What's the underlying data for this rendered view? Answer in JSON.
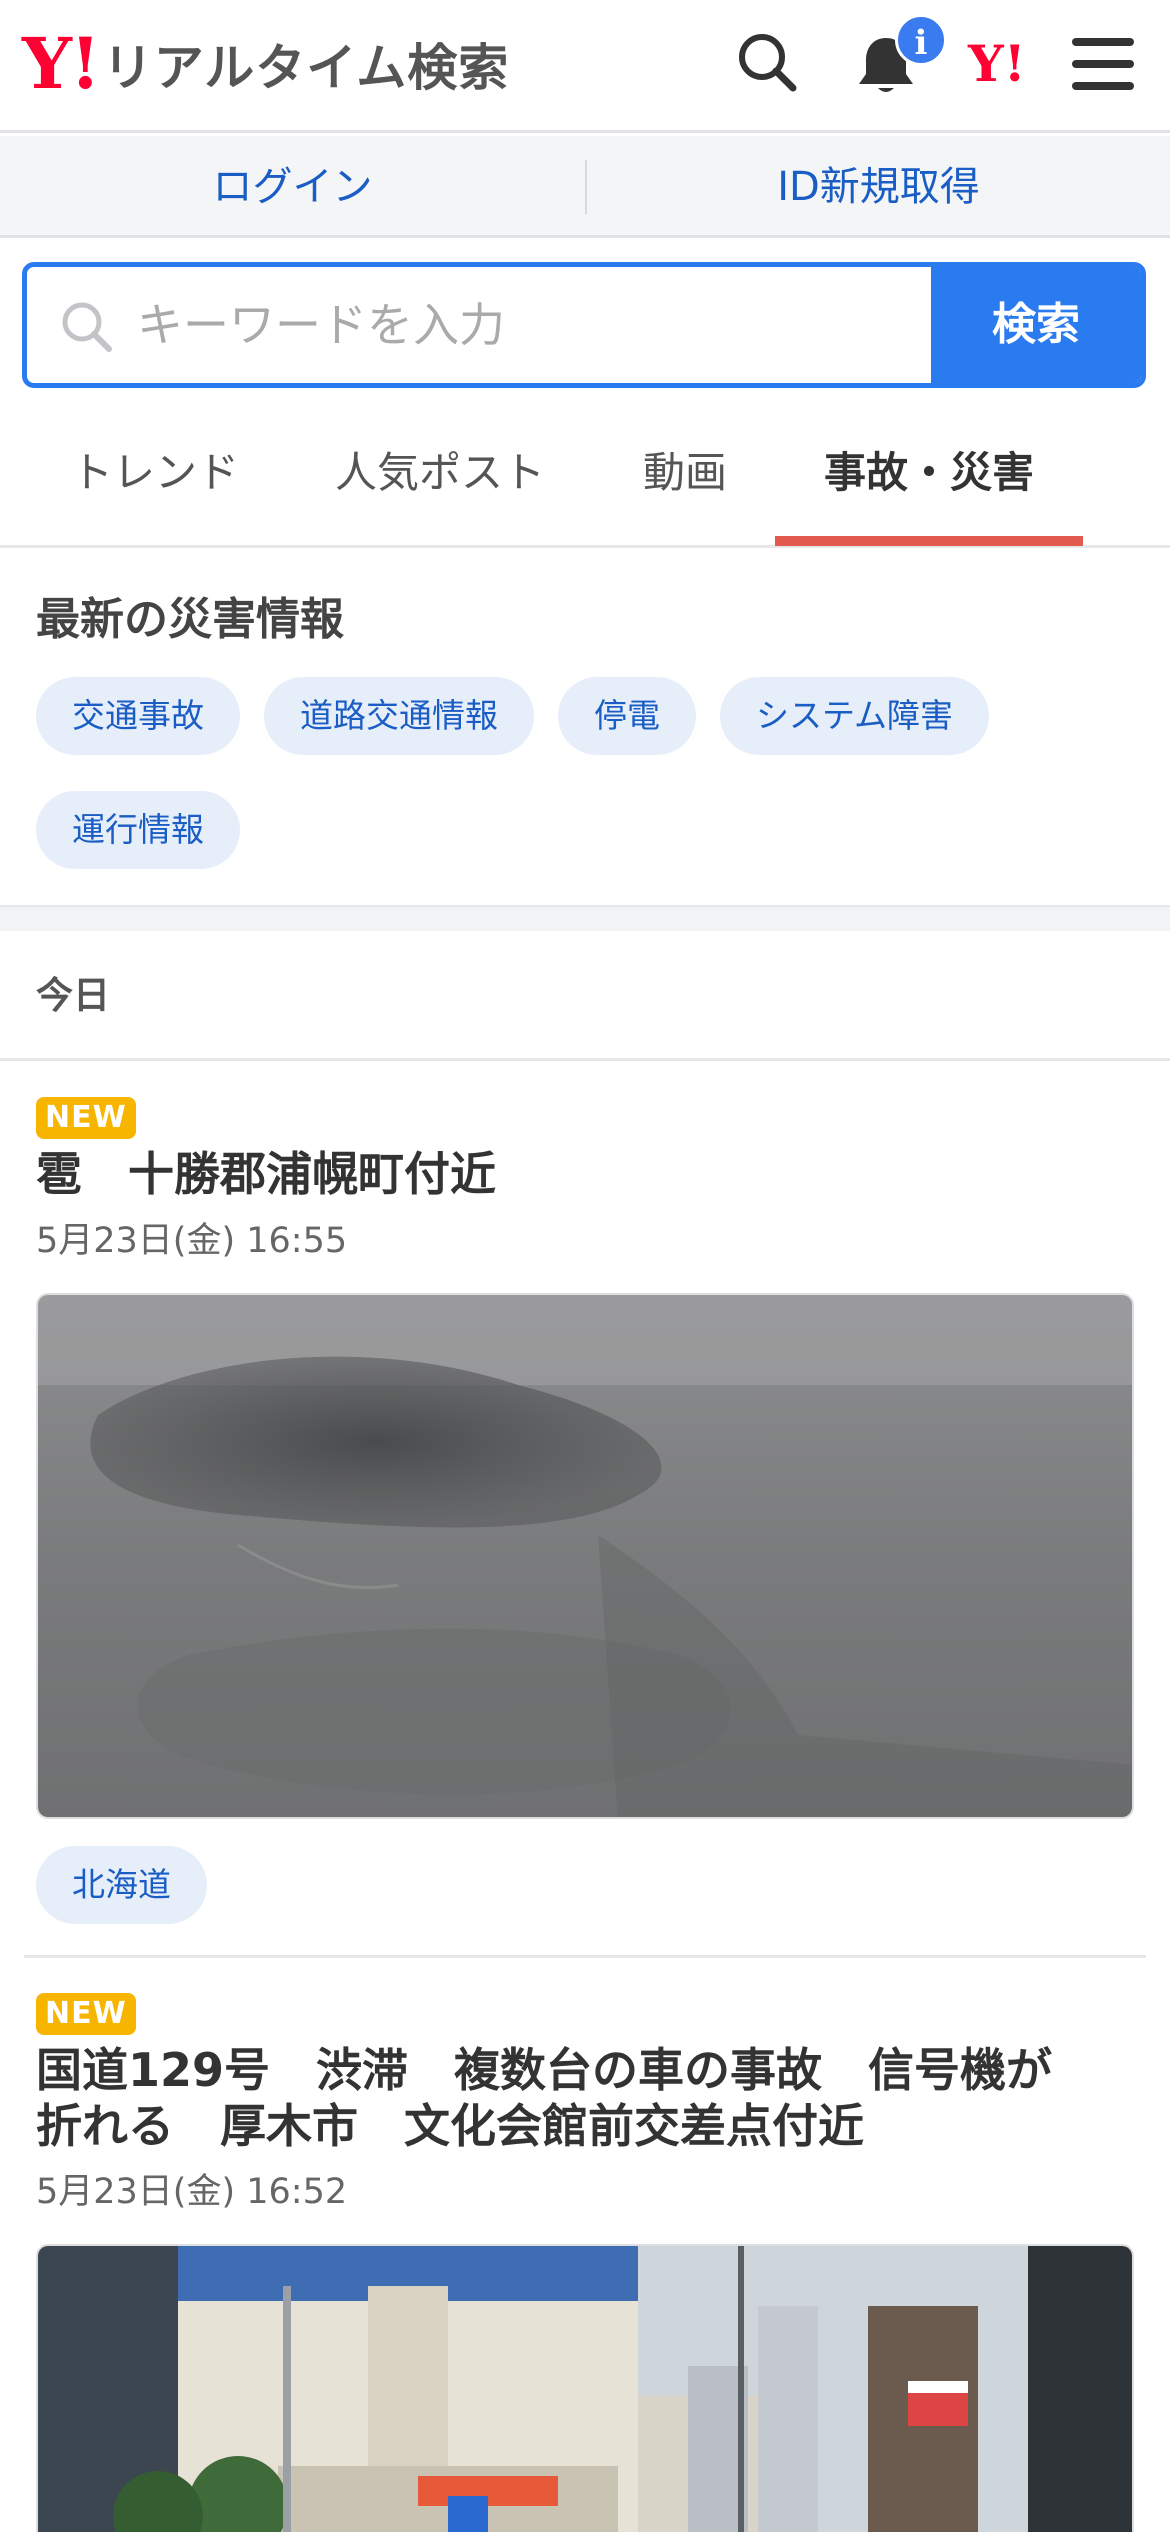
{
  "header": {
    "logo_mark": "Y!",
    "logo_text": "リアルタイム検索",
    "notification_badge": "i",
    "ymark": "Y!",
    "icons": [
      "search-icon",
      "bell-icon",
      "yahoo-icon",
      "hamburger-menu-icon"
    ]
  },
  "loginbar": {
    "login": "ログイン",
    "register": "ID新規取得"
  },
  "search": {
    "placeholder": "キーワードを入力",
    "button": "検索"
  },
  "tabs": [
    {
      "label": "トレンド",
      "active": false
    },
    {
      "label": "人気ポスト",
      "active": false
    },
    {
      "label": "動画",
      "active": false
    },
    {
      "label": "事故・災害",
      "active": true
    }
  ],
  "disaster": {
    "title": "最新の災害情報",
    "chips": [
      "交通事故",
      "道路交通情報",
      "停電",
      "システム障害",
      "運行情報"
    ]
  },
  "today_label": "今日",
  "posts": [
    {
      "badge": "NEW",
      "title": "雹　十勝郡浦幌町付近",
      "time": "5月23日(金) 16:55",
      "tag": "北海道"
    },
    {
      "badge": "NEW",
      "title_line1": "国道129号　渋滞　複数台の車の事故　信号機が",
      "title_line2": "折れる　厚木市　文化会館前交差点付近",
      "time": "5月23日(金) 16:52"
    }
  ],
  "colors": {
    "brand_red": "#ff0033",
    "accent_blue": "#2a7bf0",
    "link_blue": "#1a5dc4",
    "tab_underline": "#e35a4f",
    "badge_yellow": "#f7b500"
  }
}
